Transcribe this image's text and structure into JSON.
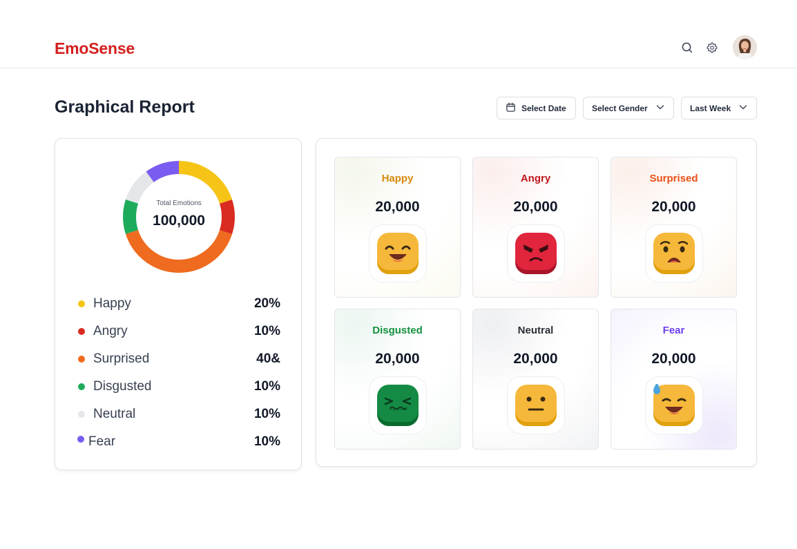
{
  "app": {
    "name": "EmoSense"
  },
  "header": {
    "icons": [
      "search-icon",
      "gear-icon",
      "avatar"
    ]
  },
  "page": {
    "title": "Graphical Report"
  },
  "filters": {
    "date_label": "Select Date",
    "gender_label": "Select Gender",
    "period_label": "Last Week"
  },
  "summary": {
    "total_label": "Total Emotions",
    "total_value": "100,000"
  },
  "chart_data": {
    "type": "pie",
    "categories": [
      "Happy",
      "Angry",
      "Surprised",
      "Disgusted",
      "Neutral",
      "Fear"
    ],
    "values": [
      20,
      10,
      40,
      10,
      10,
      10
    ],
    "value_labels": [
      "20%",
      "10%",
      "40&",
      "10%",
      "10%",
      "10%"
    ],
    "colors": [
      "#f6c417",
      "#d92b21",
      "#ef6b1f",
      "#1dab5b",
      "#e4e6ea",
      "#7b5cf0"
    ],
    "legend": "bottom"
  },
  "legend": [
    {
      "name": "Happy",
      "pct": "20%",
      "color": "#f6c417"
    },
    {
      "name": "Angry",
      "pct": "10%",
      "color": "#d92b21"
    },
    {
      "name": "Surprised",
      "pct": "40&",
      "color": "#ef6b1f"
    },
    {
      "name": "Disgusted",
      "pct": "10%",
      "color": "#1dab5b"
    },
    {
      "name": "Neutral",
      "pct": "10%",
      "color": "#e4e6ea"
    },
    {
      "name": "Fear",
      "pct": "10%",
      "color": "#7b5cf0"
    }
  ],
  "emotions": [
    {
      "name": "Happy",
      "count": "20,000",
      "color": "#d68a0c",
      "icon": "happy-face-icon"
    },
    {
      "name": "Angry",
      "count": "20,000",
      "color": "#c0151b",
      "icon": "angry-face-icon"
    },
    {
      "name": "Surprised",
      "count": "20,000",
      "color": "#ea4f15",
      "icon": "surprised-face-icon"
    },
    {
      "name": "Disgusted",
      "count": "20,000",
      "color": "#14903f",
      "icon": "disgusted-face-icon"
    },
    {
      "name": "Neutral",
      "count": "20,000",
      "color": "#2b2f36",
      "icon": "neutral-face-icon"
    },
    {
      "name": "Fear",
      "count": "20,000",
      "color": "#6d3ff0",
      "icon": "fear-face-icon"
    }
  ]
}
